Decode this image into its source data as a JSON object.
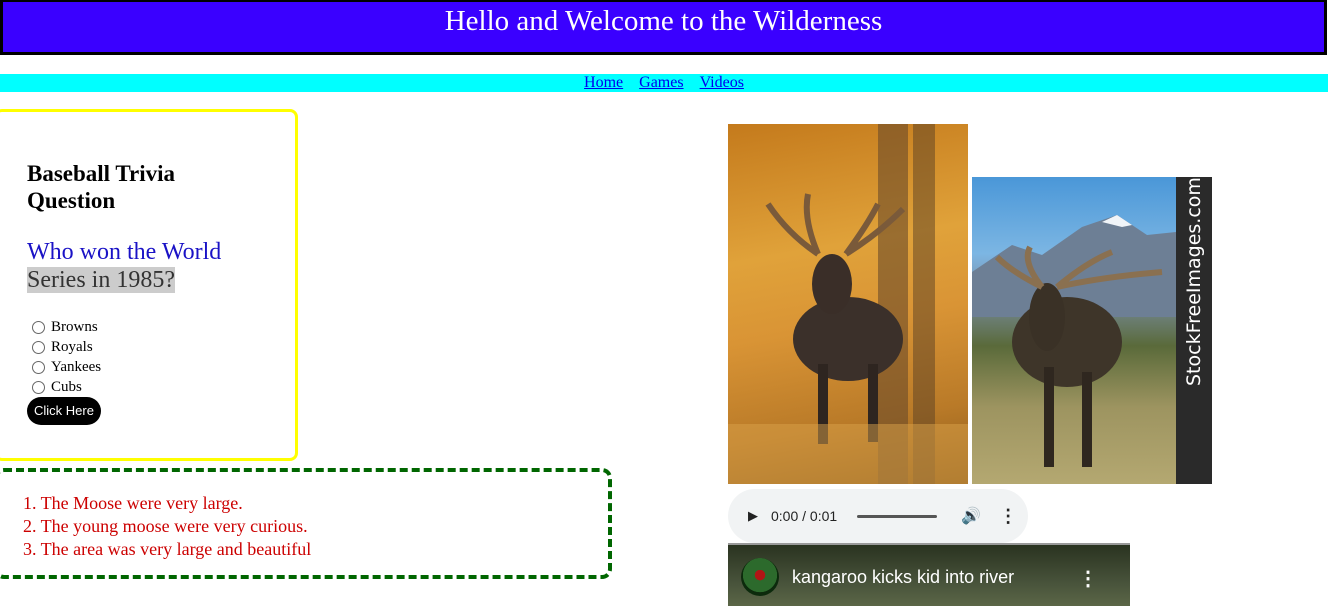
{
  "header": {
    "title": "Hello and Welcome to the Wilderness"
  },
  "nav": {
    "items": [
      "Home",
      "Games",
      "Videos"
    ]
  },
  "trivia": {
    "heading": "Baseball Trivia Question",
    "question_part1": "Who won the World",
    "question_part2": "Series in 1985?",
    "options": [
      "Browns",
      "Royals",
      "Yankees",
      "Cubs"
    ],
    "button_label": "Click Here"
  },
  "notes": {
    "items": [
      "1. The Moose were very large.",
      "2. The young moose were very curious.",
      "3. The area was very large and beautiful"
    ]
  },
  "images": {
    "photo2_watermark_brand": "StockFreeImages.com"
  },
  "audio": {
    "time": "0:00 / 0:01"
  },
  "video": {
    "title": "kangaroo kicks kid into river"
  },
  "colors": {
    "banner": "#3a00ff",
    "nav_bar": "#00ffff",
    "trivia_border": "#ffff00",
    "notes_border": "#006600",
    "notes_text": "#cc0000",
    "question_text": "#1a12c6"
  },
  "icons": {
    "play": "play-icon",
    "volume": "volume-icon",
    "more": "more-vert-icon"
  }
}
